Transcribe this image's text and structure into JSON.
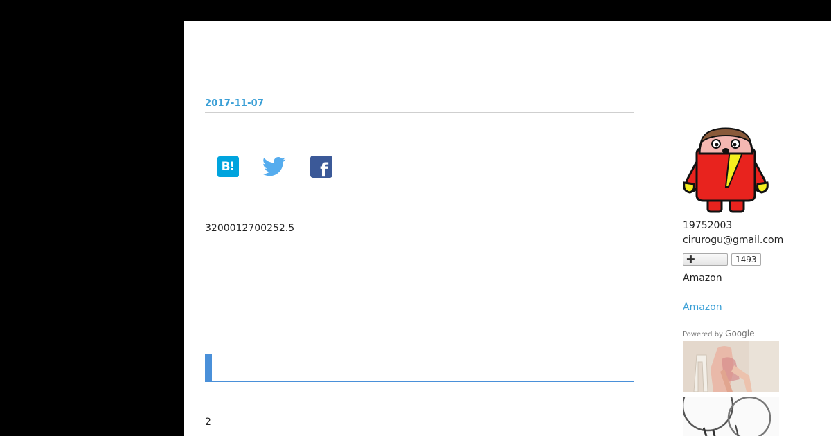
{
  "post": {
    "date": "2017-11-07",
    "body_text": "3200012700252.5",
    "section_number": "2"
  },
  "share": {
    "hatena_label": "B!",
    "facebook_label": "f"
  },
  "sidebar": {
    "id": "19752003",
    "email": "cirurogu@gmail.com",
    "follow_button_label": "✚",
    "follower_count": "1493",
    "amazon_label": "Amazon",
    "amazon_link": "Amazon",
    "powered_by_text": "Powered by",
    "powered_by_brand": "Google"
  },
  "colors": {
    "accent": "#3a9fd6",
    "heading_bar": "#4a90d9",
    "hatena": "#00a4de",
    "twitter": "#55acee",
    "facebook": "#3b5998",
    "background": "#000000"
  },
  "icons": {
    "hatena": "hatena-bookmark-icon",
    "twitter": "twitter-bird-icon",
    "facebook": "facebook-icon",
    "follow": "plus-icon"
  }
}
